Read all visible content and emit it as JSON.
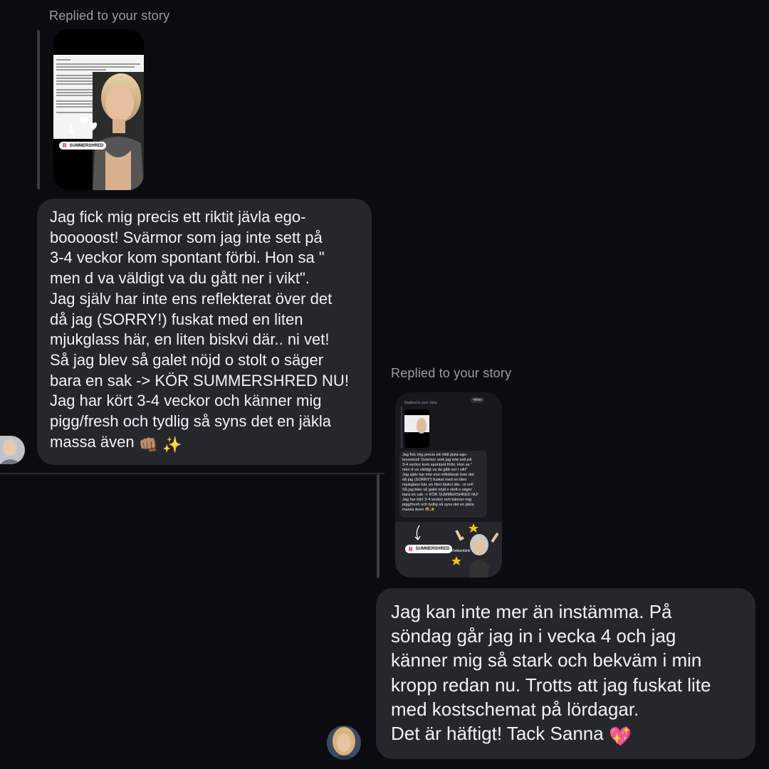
{
  "thread": {
    "message1": {
      "replied_label": "Replied to your story",
      "story_sticker": "SUMMERSHRED",
      "text": "Jag fick mig precis ett riktit jävla ego-\nbooooost! Svärmor som jag inte sett på\n3-4 veckor kom spontant förbi. Hon sa \"\nmen d va väldigt va du gått ner i vikt\".\nJag själv har inte ens reflekterat över det\ndå jag (SORRY!) fuskat med en liten\nmjukglass här, en liten biskvi där.. ni vet!\nSå jag blev så galet nöjd o stolt o säger\nbara en sak -> KÖR SUMMERSHRED NU!\nJag har kört 3-4 veckor och känner mig\npigg/fresh och tydlig så syns det en jäkla\nmassa även",
      "emojis": "👊🏽 ✨"
    },
    "message2": {
      "replied_label": "Replied to your story",
      "story": {
        "header": "Replied to your story",
        "badge": "•Rklm",
        "sticker": "SUMMERSHRED",
        "ad_label": "• Reklamlänk",
        "quoted_text": "Jag fick mig precis ett riktit jävla ego-\nbooooost! Svärmor som jag inte sett på\n3-4 veckor kom spontant förbi. Hon sa \"\nmen d va väldigt va du gått ner i vikt\"\nJag själv har inte ens reflekterat över det\ndå jag (SORRY!) fuskat med en liten\nmjukglass här, en liten biskvi där.. ni vet!\nSå jag blev så galet nöjd o stolt o säger\nbara en sak -> KÖR SUMMERSHRED NU!\nJag har kört 3-4 veckor och känner mig\npigg/fresh och tydlig så syns det en jäkla\nmassa även 👊🏽✨"
      },
      "text": "Jag kan inte mer än instämma. På\nsöndag går jag in i vecka 4 och jag\nkänner mig så stark och bekväm i min\nkropp redan nu. Trotts att jag fuskat lite\nmed kostschemat på lördagar.\nDet är häftigt! Tack Sanna",
      "emoji": "💖"
    }
  },
  "colors": {
    "background": "#0b0c10",
    "bubble": "#26272c",
    "label": "#9a9ca3"
  }
}
